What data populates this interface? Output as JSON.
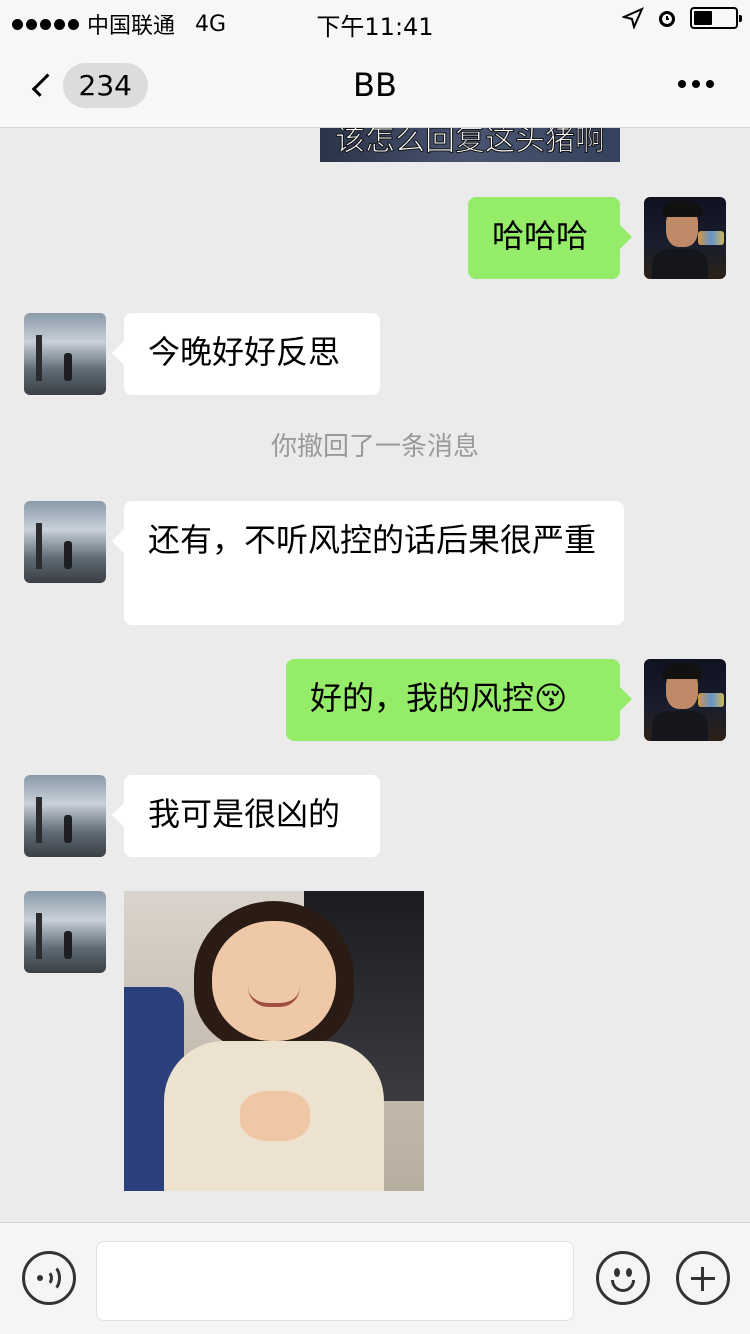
{
  "status_bar": {
    "carrier": "中国联通",
    "network": "4G",
    "time": "下午11:41"
  },
  "nav": {
    "unread_count": "234",
    "title": "BB"
  },
  "messages": [
    {
      "side": "right",
      "type": "sticker",
      "text": "该怎么回复这头猪啊"
    },
    {
      "side": "right",
      "type": "text",
      "text": "哈哈哈"
    },
    {
      "side": "left",
      "type": "text",
      "text": "今晚好好反思"
    },
    {
      "side": "system",
      "type": "recall",
      "text": "你撤回了一条消息"
    },
    {
      "side": "left",
      "type": "text",
      "text": "还有，不听风控的话后果很严重"
    },
    {
      "side": "right",
      "type": "text",
      "text": "好的，我的风控😚"
    },
    {
      "side": "left",
      "type": "text",
      "text": "我可是很凶的"
    },
    {
      "side": "left",
      "type": "image"
    }
  ],
  "input_bar": {
    "value": "",
    "icons": [
      "voice-icon",
      "emoji-icon",
      "plus-icon"
    ]
  },
  "colors": {
    "self_bubble": "#95ec69",
    "other_bubble": "#ffffff",
    "background": "#ebebeb"
  }
}
